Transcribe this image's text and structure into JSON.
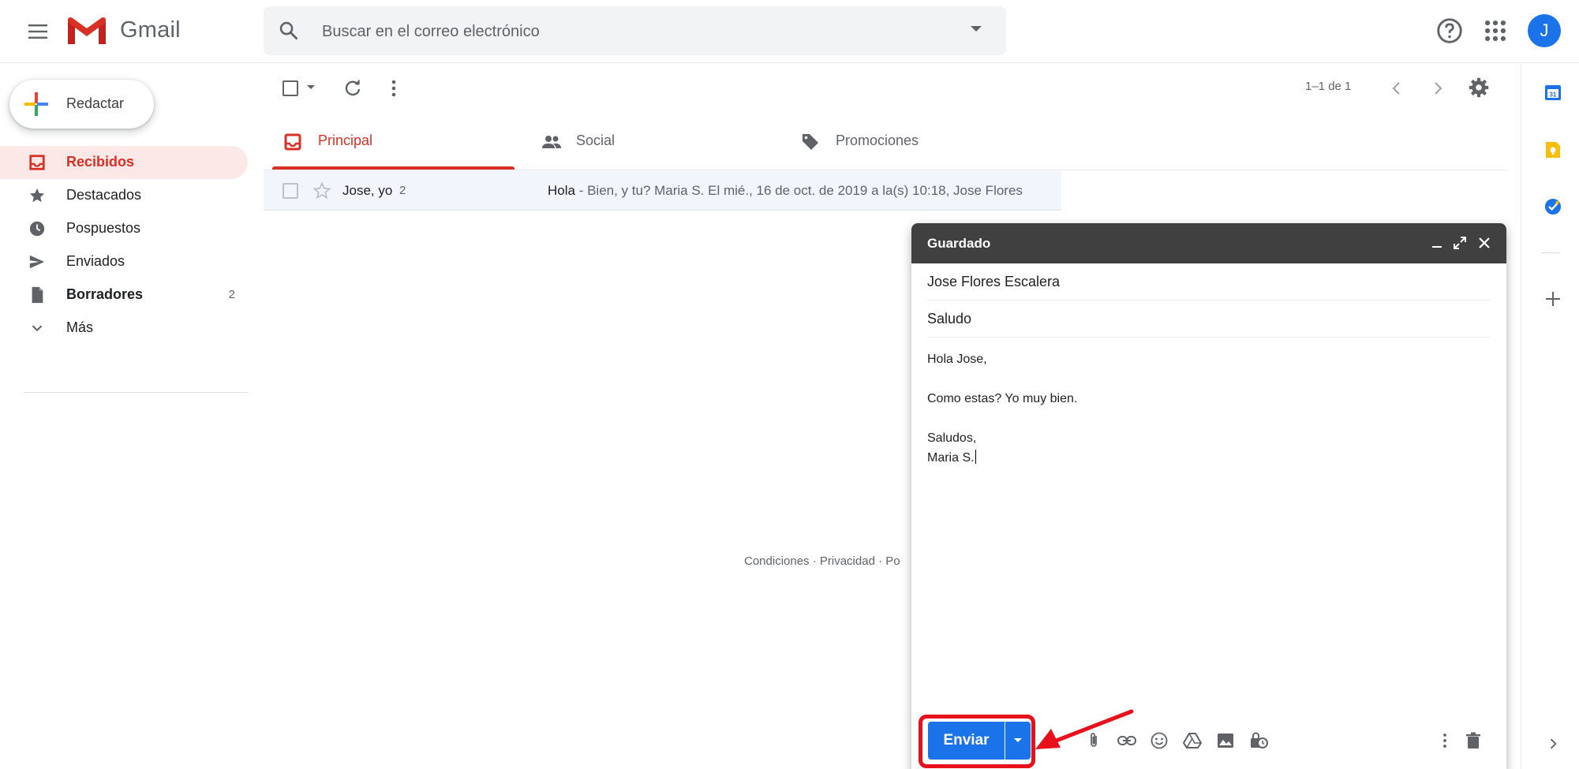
{
  "app": {
    "name": "Gmail"
  },
  "search": {
    "placeholder": "Buscar en el correo electrónico"
  },
  "user": {
    "avatar_letter": "J"
  },
  "compose_button": {
    "label": "Redactar"
  },
  "sidebar": {
    "items": [
      {
        "label": "Recibidos",
        "icon": "inbox-icon",
        "active": true
      },
      {
        "label": "Destacados",
        "icon": "star-icon"
      },
      {
        "label": "Pospuestos",
        "icon": "clock-icon"
      },
      {
        "label": "Enviados",
        "icon": "send-icon"
      },
      {
        "label": "Borradores",
        "icon": "draft-icon",
        "count": "2"
      },
      {
        "label": "Más",
        "icon": "chevron-down-icon"
      }
    ]
  },
  "toolbar": {
    "pagination": "1–1 de 1"
  },
  "tabs": [
    {
      "label": "Principal",
      "icon": "inbox-icon",
      "active": true
    },
    {
      "label": "Social",
      "icon": "people-icon"
    },
    {
      "label": "Promociones",
      "icon": "tag-icon"
    }
  ],
  "emails": [
    {
      "sender": "Jose, yo",
      "count": "2",
      "subject": "Hola",
      "snippet": " - Bien, y tu? Maria S. El mié., 16 de oct. de 2019 a la(s) 10:18, Jose Flores"
    }
  ],
  "footer": {
    "text": "Condiciones · Privacidad · Po"
  },
  "compose": {
    "title": "Guardado",
    "to": "Jose Flores Escalera",
    "subject": "Saludo",
    "body": [
      "Hola Jose,",
      "",
      "Como estas? Yo muy bien.",
      "",
      "Saludos,",
      "Maria S."
    ],
    "send_label": "Enviar"
  },
  "colors": {
    "accent": "#d93025",
    "primary": "#1a73e8",
    "highlight": "#e8101a",
    "compose_header": "#404040"
  }
}
